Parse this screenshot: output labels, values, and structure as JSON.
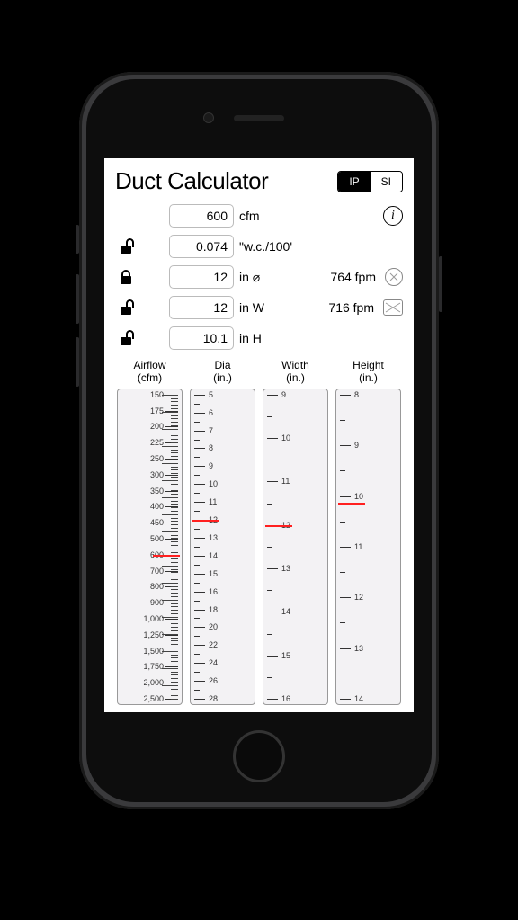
{
  "title": "Duct Calculator",
  "units_toggle": {
    "ip": "IP",
    "si": "SI",
    "active": "ip"
  },
  "inputs": {
    "airflow": {
      "value": "600",
      "unit": "cfm",
      "lock": null
    },
    "friction": {
      "value": "0.074",
      "unit": "\"w.c./100'",
      "lock": "open"
    },
    "diameter": {
      "value": "12",
      "unit": "in ⌀",
      "lock": "closed"
    },
    "width": {
      "value": "12",
      "unit": "in W",
      "lock": "open"
    },
    "height": {
      "value": "10.1",
      "unit": "in H",
      "lock": "open"
    }
  },
  "velocities": {
    "round": {
      "value": "764 fpm"
    },
    "rect": {
      "value": "716 fpm"
    }
  },
  "scales": {
    "airflow": {
      "header": "Airflow\n(cfm)",
      "labels": [
        "150",
        "175",
        "200",
        "225",
        "250",
        "300",
        "350",
        "400",
        "450",
        "500",
        "600",
        "700",
        "800",
        "900",
        "1,000",
        "1,250",
        "1,500",
        "1,750",
        "2,000",
        "2,500"
      ],
      "indicator_at": "600"
    },
    "dia": {
      "header": "Dia\n(in.)",
      "labels": [
        "5",
        "6",
        "7",
        "8",
        "9",
        "10",
        "11",
        "12",
        "13",
        "14",
        "15",
        "16",
        "18",
        "20",
        "22",
        "24",
        "26",
        "28"
      ],
      "indicator_at": "12"
    },
    "width": {
      "header": "Width\n(in.)",
      "labels": [
        "9",
        "10",
        "11",
        "12",
        "13",
        "14",
        "15",
        "16"
      ],
      "indicator_at": "12"
    },
    "height": {
      "header": "Height\n(in.)",
      "labels": [
        "8",
        "9",
        "10",
        "11",
        "12",
        "13",
        "14"
      ],
      "indicator_at_fraction": 0.355
    }
  }
}
